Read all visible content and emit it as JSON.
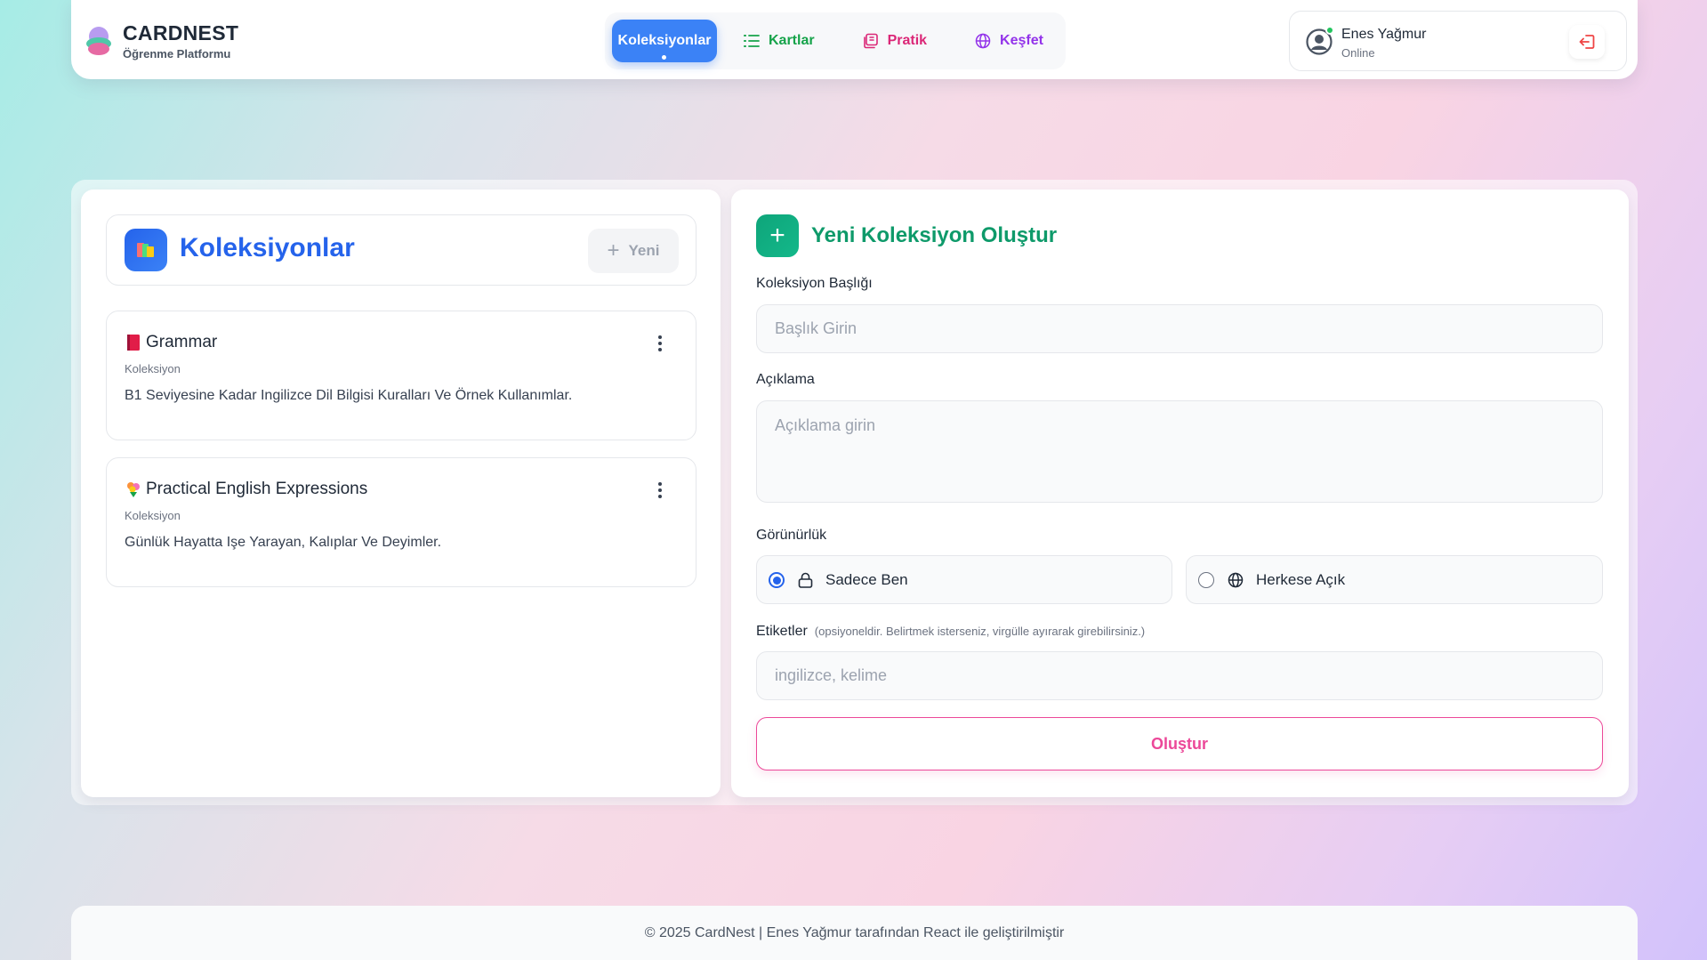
{
  "brand": {
    "title": "CARDNEST",
    "subtitle": "Öğrenme Platformu"
  },
  "nav": {
    "items": [
      {
        "label": "Koleksiyonlar",
        "icon": "collection-icon",
        "active": true
      },
      {
        "label": "Kartlar",
        "icon": "list-icon",
        "color": "#16a34a"
      },
      {
        "label": "Pratik",
        "icon": "practice-icon",
        "color": "#db2777"
      },
      {
        "label": "Keşfet",
        "icon": "globe-icon",
        "color": "#9333ea"
      }
    ]
  },
  "user": {
    "name": "Enes Yağmur",
    "status": "Online"
  },
  "collections": {
    "title": "Koleksiyonlar",
    "new_label": "Yeni",
    "items": [
      {
        "emoji": "red-book",
        "title": "Grammar",
        "kind": "Koleksiyon",
        "description": "B1 Seviyesine Kadar Ingilizce Dil Bilgisi Kuralları Ve Örnek Kullanımlar."
      },
      {
        "emoji": "flower-bouquet",
        "title": "Practical English Expressions",
        "kind": "Koleksiyon",
        "description": "Günlük Hayatta Işe Yarayan, Kalıplar Ve Deyimler."
      }
    ]
  },
  "form": {
    "title": "Yeni Koleksiyon Oluştur",
    "title_label": "Koleksiyon Başlığı",
    "title_placeholder": "Başlık Girin",
    "desc_label": "Açıklama",
    "desc_placeholder": "Açıklama girin",
    "visibility_label": "Görünürlük",
    "visibility_options": [
      {
        "label": "Sadece Ben",
        "selected": true
      },
      {
        "label": "Herkese Açık",
        "selected": false
      }
    ],
    "tags_label": "Etiketler",
    "tags_hint": "(opsiyoneldir. Belirtmek isterseniz, virgülle ayırarak girebilirsiniz.)",
    "tags_placeholder": "ingilizce, kelime",
    "submit_label": "Oluştur"
  },
  "footer": {
    "text": "© 2025 CardNest | Enes Yağmur tarafından React ile geliştirilmiştir"
  },
  "colors": {
    "primary": "#3b82f6",
    "success": "#0e9a6a",
    "accent": "#ec4899"
  }
}
